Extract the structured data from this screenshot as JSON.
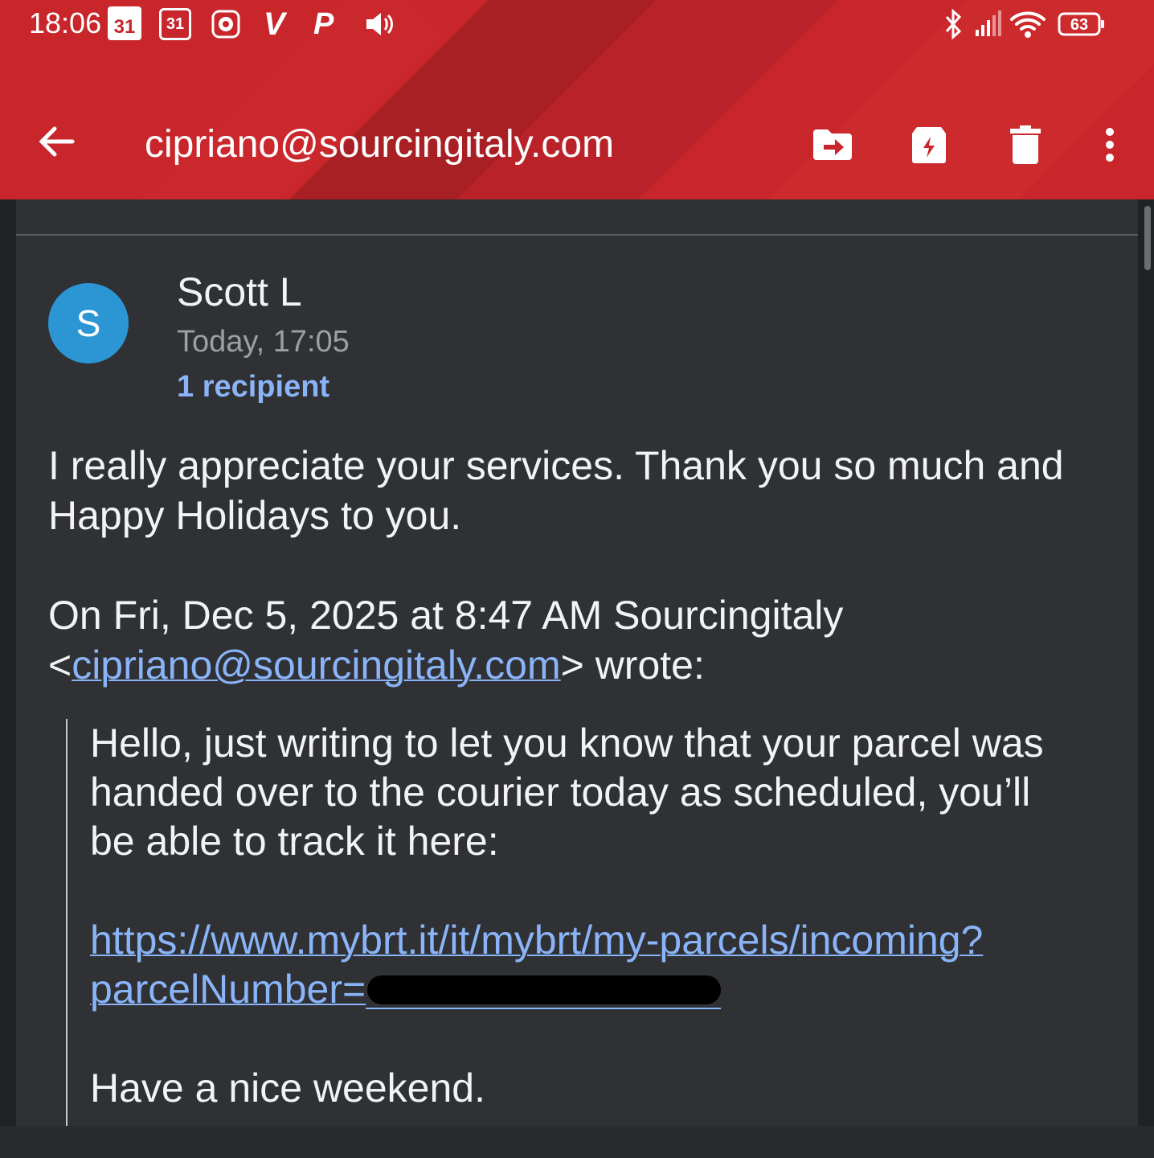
{
  "status_bar": {
    "time": "18:06",
    "calendar_day_1": "31",
    "calendar_day_2": "31",
    "battery": "63",
    "icons": [
      "calendar-icon",
      "calendar-outline-icon",
      "lion-app-icon",
      "v-app-icon",
      "paypal-icon",
      "volume-icon",
      "bluetooth-icon",
      "signal-icon",
      "wifi-icon",
      "battery-icon"
    ]
  },
  "toolbar": {
    "title": "cipriano@sourcingitaly.com",
    "actions": [
      "back-arrow-icon",
      "move-to-folder-icon",
      "snooze-icon",
      "delete-icon",
      "more-vert-icon"
    ]
  },
  "message": {
    "avatar_letter": "S",
    "avatar_color": "#2c95d4",
    "sender": "Scott L",
    "date": "Today, 17:05",
    "recipients": "1 recipient",
    "reply_line1": "I really appreciate your services. Thank you so much and",
    "reply_line2": "Happy Holidays to you.",
    "quote_header_1": "On Fri, Dec 5, 2025 at 8:47 AM Sourcingitaly",
    "quote_header_lt": "<",
    "quote_header_email": "cipriano@sourcingitaly.com",
    "quote_header_gt": "> wrote:",
    "quoted_line1": "Hello, just writing to let you know that your parcel was",
    "quoted_line2": "handed over to the courier today as scheduled, you’ll",
    "quoted_line3": "be able to track it here:",
    "tracking_link_line1": "https://www.mybrt.it/it/mybrt/my-parcels/incoming?",
    "tracking_link_line2": "parcelNumber=",
    "closing": "Have a nice weekend."
  },
  "colors": {
    "header_red": "#c8262b",
    "link_blue": "#8ab4f8",
    "background": "#303134"
  }
}
